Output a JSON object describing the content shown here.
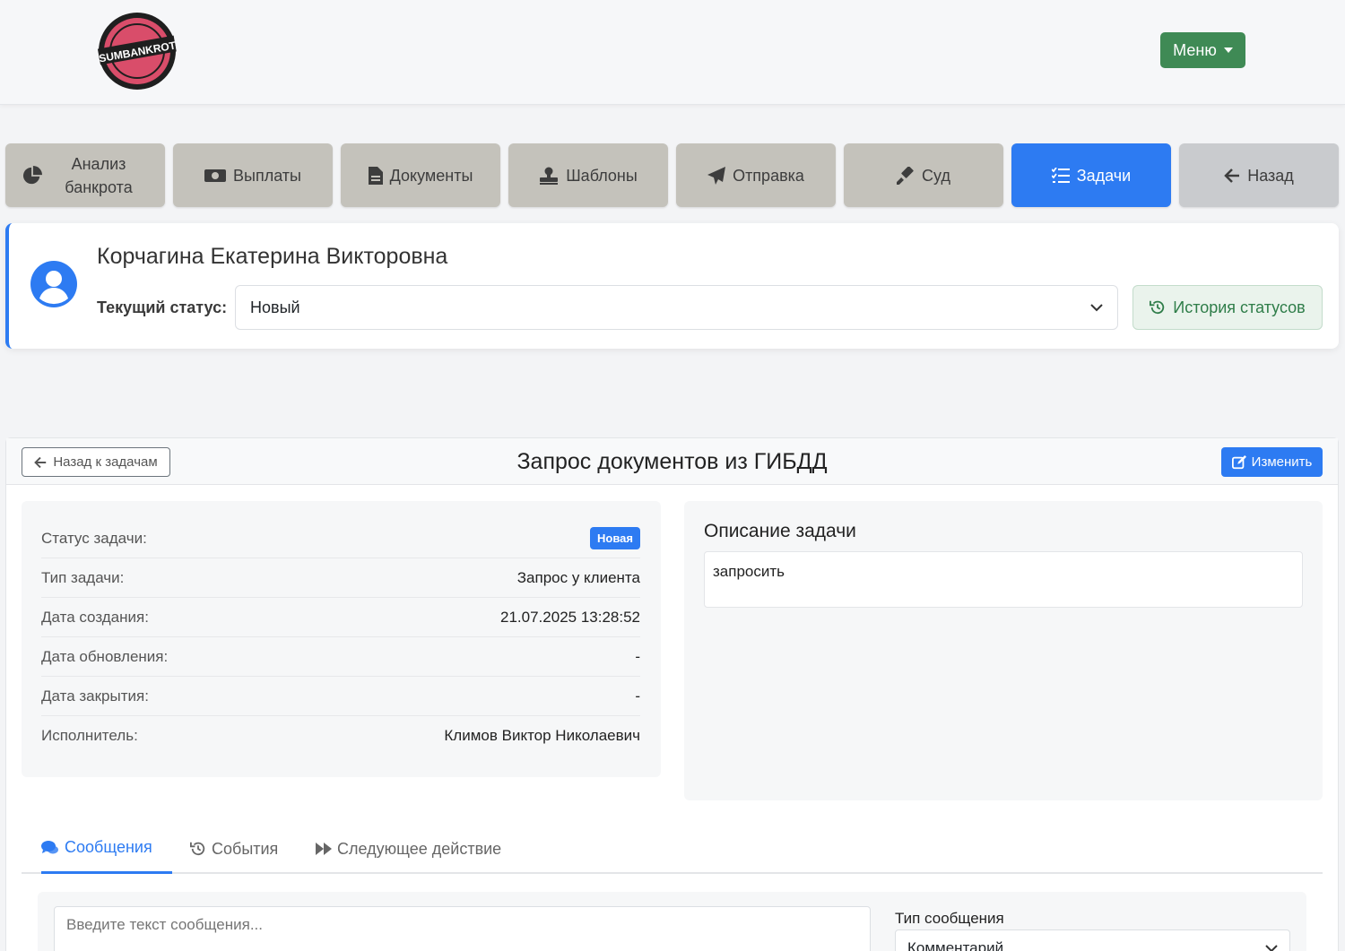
{
  "header": {
    "logo_alt": "SUMBANKROT",
    "menu_label": "Меню"
  },
  "nav": {
    "items": [
      {
        "label": "Анализ банкрота",
        "icon": "pie-chart-icon"
      },
      {
        "label": "Выплаты",
        "icon": "money-bill-icon"
      },
      {
        "label": "Документы",
        "icon": "file-icon"
      },
      {
        "label": "Шаблоны",
        "icon": "stamp-icon"
      },
      {
        "label": "Отправка",
        "icon": "paper-plane-icon"
      },
      {
        "label": "Суд",
        "icon": "gavel-icon"
      },
      {
        "label": "Задачи",
        "icon": "list-check-icon",
        "active": true
      },
      {
        "label": "Назад",
        "icon": "arrow-left-icon"
      }
    ]
  },
  "client": {
    "name": "Корчагина Екатерина Викторовна",
    "status_label": "Текущий статус:",
    "status_value": "Новый",
    "history_button": "История статусов"
  },
  "task": {
    "back_button": "Назад к задачам",
    "title": "Запрос документов из ГИБДД",
    "edit_button": "Изменить",
    "info": [
      {
        "key": "Статус задачи:",
        "value": "Новая",
        "badge": true
      },
      {
        "key": "Тип задачи:",
        "value": "Запрос у клиента"
      },
      {
        "key": "Дата создания:",
        "value": "21.07.2025 13:28:52"
      },
      {
        "key": "Дата обновления:",
        "value": "-"
      },
      {
        "key": "Дата закрытия:",
        "value": "-"
      },
      {
        "key": "Исполнитель:",
        "value": "Климов Виктор Николаевич"
      }
    ],
    "description_title": "Описание задачи",
    "description_text": "запросить"
  },
  "tabs": [
    {
      "label": "Сообщения",
      "icon": "comments-icon",
      "active": true
    },
    {
      "label": "События",
      "icon": "history-icon"
    },
    {
      "label": "Следующее действие",
      "icon": "forward-icon"
    }
  ],
  "message": {
    "placeholder": "Введите текст сообщения...",
    "type_label": "Тип сообщения",
    "type_value": "Комментарий"
  },
  "colors": {
    "primary": "#2d7bf2",
    "success": "#3f8a55",
    "nav_bg": "#c4c2bb"
  }
}
